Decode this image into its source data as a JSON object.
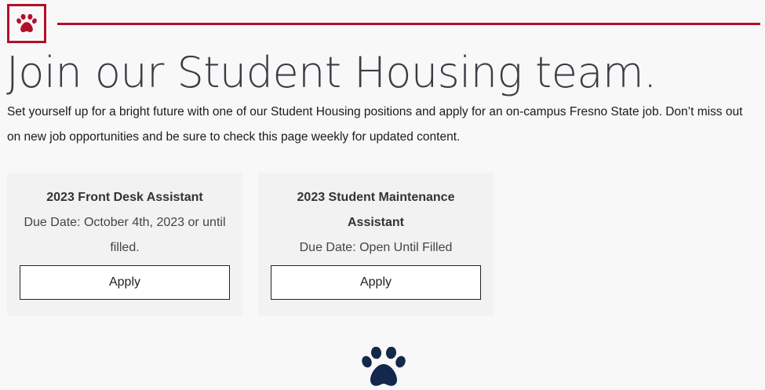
{
  "header": {
    "logo_icon": "paw-icon",
    "accent_color": "#b1102b"
  },
  "main": {
    "title": "Join our Student Housing team.",
    "intro": "Set yourself up for a bright future with one of our Student Housing positions and apply for an on-campus Fresno State job. Don’t miss out on new job opportunities and be sure to check this page weekly for updated content."
  },
  "jobs": [
    {
      "title": "2023 Front Desk Assistant",
      "due": "Due Date: October 4th, 2023 or until filled.",
      "apply_label": "Apply"
    },
    {
      "title": "2023 Student Maintenance Assistant",
      "due": "Due Date: Open Until Filled",
      "apply_label": "Apply"
    }
  ],
  "footer": {
    "paw_icon": "paw-icon",
    "paw_color": "#13284c"
  }
}
